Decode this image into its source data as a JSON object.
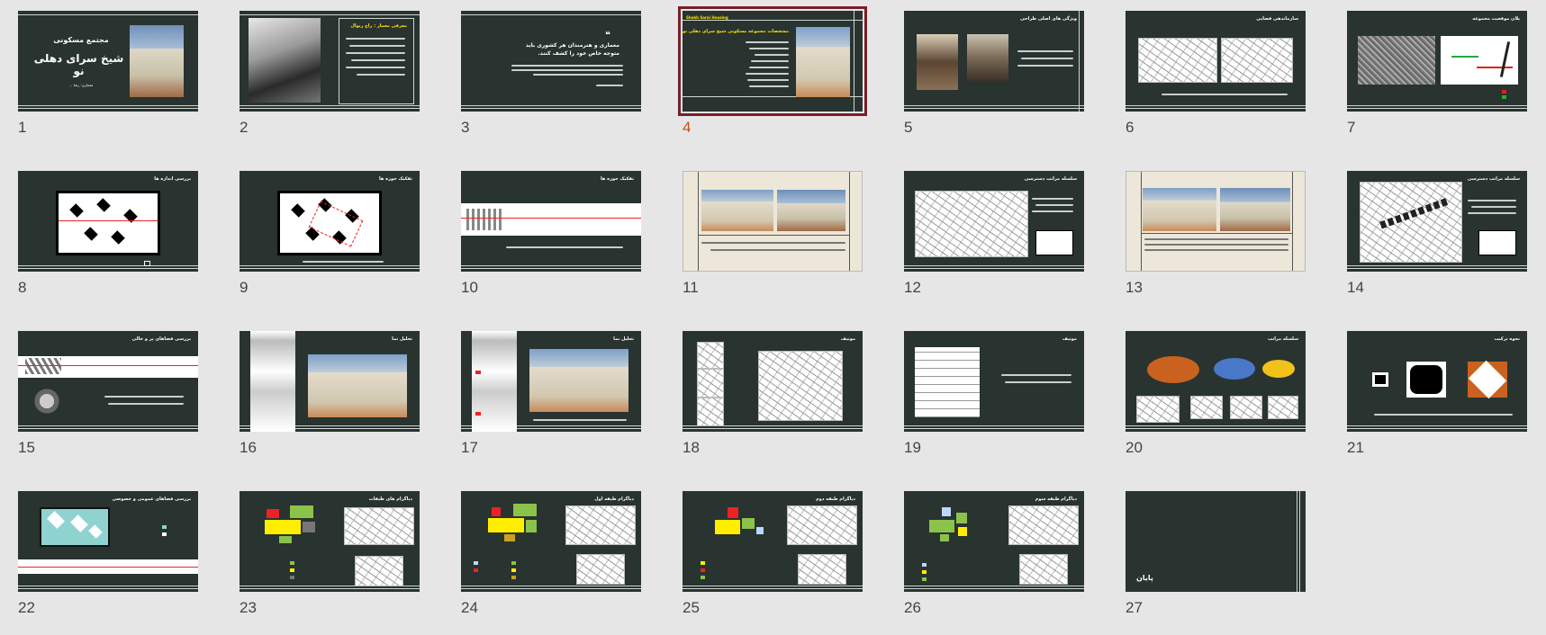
{
  "slides": [
    {
      "num": "1",
      "title": "مجتمع مسکونی",
      "subtitle": "شیخ سرای دهلی نو",
      "author": "معماری: رضا ..."
    },
    {
      "num": "2",
      "title": "معرفی معمار : راج ریوال"
    },
    {
      "num": "3",
      "quote_mark": "❝",
      "quote": "معماری و هنرمندان هر کشوری باید متوجه خاص خود را کشف کنند."
    },
    {
      "num": "4",
      "title": "مشخصات مجموعه مسکونی شیخ سرای دهلی نو",
      "tag": "Shekh Sarai Housing"
    },
    {
      "num": "5",
      "title": "ویژگی های اصلی طراحی"
    },
    {
      "num": "6",
      "title": "سازماندهی فضایی"
    },
    {
      "num": "7",
      "title": "پلان موقعیت مجموعه"
    },
    {
      "num": "8",
      "title": "بررسی اندازه ها"
    },
    {
      "num": "9",
      "title": "تفکیک حوزه ها"
    },
    {
      "num": "10",
      "title": "تفکیک حوزه ها"
    },
    {
      "num": "11"
    },
    {
      "num": "12",
      "title": "سلسله مراتب دسترسی"
    },
    {
      "num": "13"
    },
    {
      "num": "14",
      "title": "سلسله مراتب دسترسی"
    },
    {
      "num": "15",
      "title": "بررسی فضاهای پر و خالی"
    },
    {
      "num": "16",
      "title": "تحلیل نما"
    },
    {
      "num": "17",
      "title": "تحلیل نما"
    },
    {
      "num": "18",
      "title": "موتیف"
    },
    {
      "num": "19",
      "title": "موتیف"
    },
    {
      "num": "20",
      "title": "سلسله مراتب"
    },
    {
      "num": "21",
      "title": "نحوه ترکیب"
    },
    {
      "num": "22",
      "title": "بررسی فضاهای عمومی و خصوصی"
    },
    {
      "num": "23",
      "title": "دیاگرام های طبقات"
    },
    {
      "num": "24",
      "title": "دیاگرام طبقه اول"
    },
    {
      "num": "25",
      "title": "دیاگرام طبقه دوم"
    },
    {
      "num": "26",
      "title": "دیاگرام طبقه سوم"
    },
    {
      "num": "27",
      "end_text": "پایان"
    }
  ],
  "selected_slide": "4",
  "colors": {
    "slide_bg": "#293330",
    "cream_bg": "#ece7d8",
    "accent_yellow": "#ffe600",
    "selection": "#7a1e28",
    "selected_num": "#c0511c",
    "window_bg": "#e6e6e6"
  }
}
